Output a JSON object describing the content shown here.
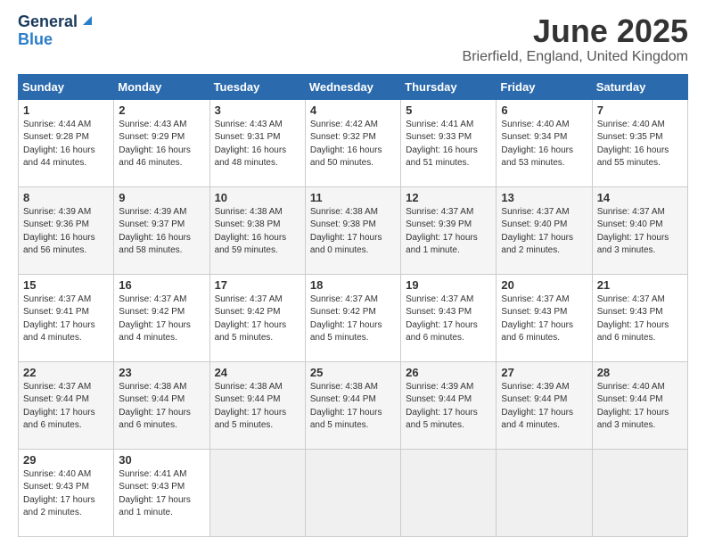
{
  "logo": {
    "line1": "General",
    "line2": "Blue"
  },
  "title": "June 2025",
  "subtitle": "Brierfield, England, United Kingdom",
  "headers": [
    "Sunday",
    "Monday",
    "Tuesday",
    "Wednesday",
    "Thursday",
    "Friday",
    "Saturday"
  ],
  "weeks": [
    [
      {
        "day": "1",
        "info": "Sunrise: 4:44 AM\nSunset: 9:28 PM\nDaylight: 16 hours\nand 44 minutes."
      },
      {
        "day": "2",
        "info": "Sunrise: 4:43 AM\nSunset: 9:29 PM\nDaylight: 16 hours\nand 46 minutes."
      },
      {
        "day": "3",
        "info": "Sunrise: 4:43 AM\nSunset: 9:31 PM\nDaylight: 16 hours\nand 48 minutes."
      },
      {
        "day": "4",
        "info": "Sunrise: 4:42 AM\nSunset: 9:32 PM\nDaylight: 16 hours\nand 50 minutes."
      },
      {
        "day": "5",
        "info": "Sunrise: 4:41 AM\nSunset: 9:33 PM\nDaylight: 16 hours\nand 51 minutes."
      },
      {
        "day": "6",
        "info": "Sunrise: 4:40 AM\nSunset: 9:34 PM\nDaylight: 16 hours\nand 53 minutes."
      },
      {
        "day": "7",
        "info": "Sunrise: 4:40 AM\nSunset: 9:35 PM\nDaylight: 16 hours\nand 55 minutes."
      }
    ],
    [
      {
        "day": "8",
        "info": "Sunrise: 4:39 AM\nSunset: 9:36 PM\nDaylight: 16 hours\nand 56 minutes."
      },
      {
        "day": "9",
        "info": "Sunrise: 4:39 AM\nSunset: 9:37 PM\nDaylight: 16 hours\nand 58 minutes."
      },
      {
        "day": "10",
        "info": "Sunrise: 4:38 AM\nSunset: 9:38 PM\nDaylight: 16 hours\nand 59 minutes."
      },
      {
        "day": "11",
        "info": "Sunrise: 4:38 AM\nSunset: 9:38 PM\nDaylight: 17 hours\nand 0 minutes."
      },
      {
        "day": "12",
        "info": "Sunrise: 4:37 AM\nSunset: 9:39 PM\nDaylight: 17 hours\nand 1 minute."
      },
      {
        "day": "13",
        "info": "Sunrise: 4:37 AM\nSunset: 9:40 PM\nDaylight: 17 hours\nand 2 minutes."
      },
      {
        "day": "14",
        "info": "Sunrise: 4:37 AM\nSunset: 9:40 PM\nDaylight: 17 hours\nand 3 minutes."
      }
    ],
    [
      {
        "day": "15",
        "info": "Sunrise: 4:37 AM\nSunset: 9:41 PM\nDaylight: 17 hours\nand 4 minutes."
      },
      {
        "day": "16",
        "info": "Sunrise: 4:37 AM\nSunset: 9:42 PM\nDaylight: 17 hours\nand 4 minutes."
      },
      {
        "day": "17",
        "info": "Sunrise: 4:37 AM\nSunset: 9:42 PM\nDaylight: 17 hours\nand 5 minutes."
      },
      {
        "day": "18",
        "info": "Sunrise: 4:37 AM\nSunset: 9:42 PM\nDaylight: 17 hours\nand 5 minutes."
      },
      {
        "day": "19",
        "info": "Sunrise: 4:37 AM\nSunset: 9:43 PM\nDaylight: 17 hours\nand 6 minutes."
      },
      {
        "day": "20",
        "info": "Sunrise: 4:37 AM\nSunset: 9:43 PM\nDaylight: 17 hours\nand 6 minutes."
      },
      {
        "day": "21",
        "info": "Sunrise: 4:37 AM\nSunset: 9:43 PM\nDaylight: 17 hours\nand 6 minutes."
      }
    ],
    [
      {
        "day": "22",
        "info": "Sunrise: 4:37 AM\nSunset: 9:44 PM\nDaylight: 17 hours\nand 6 minutes."
      },
      {
        "day": "23",
        "info": "Sunrise: 4:38 AM\nSunset: 9:44 PM\nDaylight: 17 hours\nand 6 minutes."
      },
      {
        "day": "24",
        "info": "Sunrise: 4:38 AM\nSunset: 9:44 PM\nDaylight: 17 hours\nand 5 minutes."
      },
      {
        "day": "25",
        "info": "Sunrise: 4:38 AM\nSunset: 9:44 PM\nDaylight: 17 hours\nand 5 minutes."
      },
      {
        "day": "26",
        "info": "Sunrise: 4:39 AM\nSunset: 9:44 PM\nDaylight: 17 hours\nand 5 minutes."
      },
      {
        "day": "27",
        "info": "Sunrise: 4:39 AM\nSunset: 9:44 PM\nDaylight: 17 hours\nand 4 minutes."
      },
      {
        "day": "28",
        "info": "Sunrise: 4:40 AM\nSunset: 9:44 PM\nDaylight: 17 hours\nand 3 minutes."
      }
    ],
    [
      {
        "day": "29",
        "info": "Sunrise: 4:40 AM\nSunset: 9:43 PM\nDaylight: 17 hours\nand 2 minutes."
      },
      {
        "day": "30",
        "info": "Sunrise: 4:41 AM\nSunset: 9:43 PM\nDaylight: 17 hours\nand 1 minute."
      },
      {
        "day": "",
        "info": ""
      },
      {
        "day": "",
        "info": ""
      },
      {
        "day": "",
        "info": ""
      },
      {
        "day": "",
        "info": ""
      },
      {
        "day": "",
        "info": ""
      }
    ]
  ]
}
